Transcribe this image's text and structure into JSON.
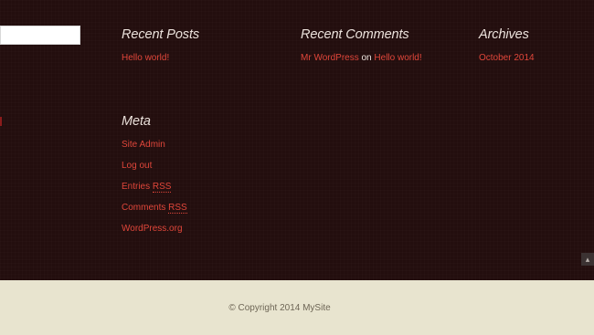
{
  "search": {
    "placeholder": ""
  },
  "widgets": {
    "recent_posts": {
      "title": "Recent Posts",
      "items": [
        "Hello world!"
      ]
    },
    "recent_comments": {
      "title": "Recent Comments",
      "author": "Mr WordPress",
      "connector": "on",
      "post": "Hello world!"
    },
    "archives": {
      "title": "Archives",
      "items": [
        "October 2014"
      ]
    },
    "meta": {
      "title": "Meta",
      "site_admin": "Site Admin",
      "log_out": "Log out",
      "entries_prefix": "Entries ",
      "entries_rss": "RSS",
      "comments_prefix": "Comments ",
      "comments_rss": "RSS",
      "wordpress_org": "WordPress.org"
    }
  },
  "scroll_top": {
    "icon": "chevron-up-icon",
    "glyph": "▴"
  },
  "footer": {
    "copyright": "© Copyright 2014 MySite"
  },
  "colors": {
    "widget_background": "#230e0e",
    "link": "#e0463a",
    "heading": "#ece2dc",
    "footer_background": "#e8e4cf",
    "footer_text": "#6e6656"
  }
}
